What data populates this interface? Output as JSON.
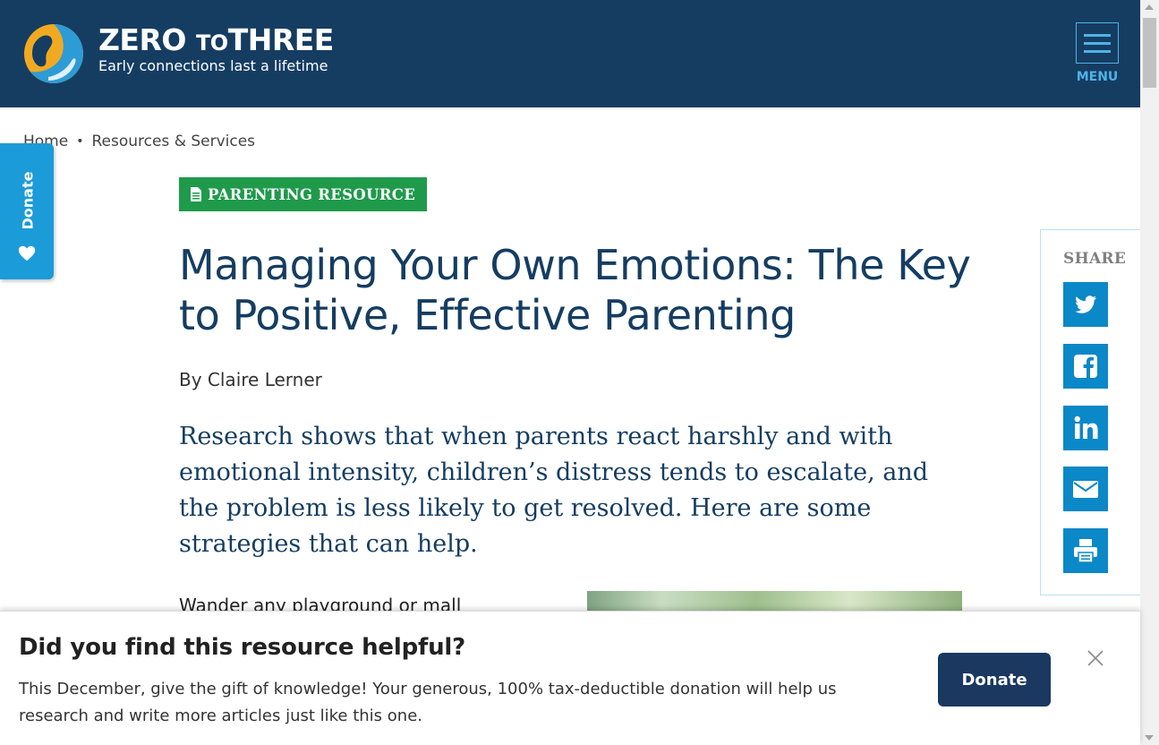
{
  "header": {
    "logo_title_1": "ZERO",
    "logo_title_2": "TO",
    "logo_title_3": "THREE",
    "logo_tagline": "Early connections last a lifetime",
    "menu_label": "MENU"
  },
  "breadcrumb": {
    "items": [
      "Home",
      "Resources & Services"
    ],
    "separator": "•"
  },
  "side_tab": {
    "label": "Donate",
    "icon": "heart-icon"
  },
  "article": {
    "badge": "PARENTING RESOURCE",
    "badge_icon": "document-icon",
    "title": "Managing Your Own Emotions: The Key to Positive, Effective Parenting",
    "byline": "By Claire Lerner",
    "lede": "Research shows that when parents react harshly and with emotional intensity, children’s distress tends to escalate, and the problem is less likely to get resolved. Here are some strategies that can help.",
    "body_start": "Wander any playground or mall"
  },
  "share": {
    "label": "SHARE",
    "buttons": [
      "twitter-icon",
      "facebook-icon",
      "linkedin-icon",
      "email-icon",
      "print-icon"
    ]
  },
  "banner": {
    "heading": "Did you find this resource helpful?",
    "text": "This December, give the gift of knowledge! Your generous, 100% tax-deductible donation will help us research and write more articles just like this one.",
    "donate_label": "Donate"
  },
  "colors": {
    "header_bg": "#153d62",
    "accent_blue": "#1b9bd7",
    "share_blue": "#0b88c7",
    "badge_green": "#1f9a4b",
    "title_navy": "#153d62",
    "donate_button": "#1a3860"
  }
}
